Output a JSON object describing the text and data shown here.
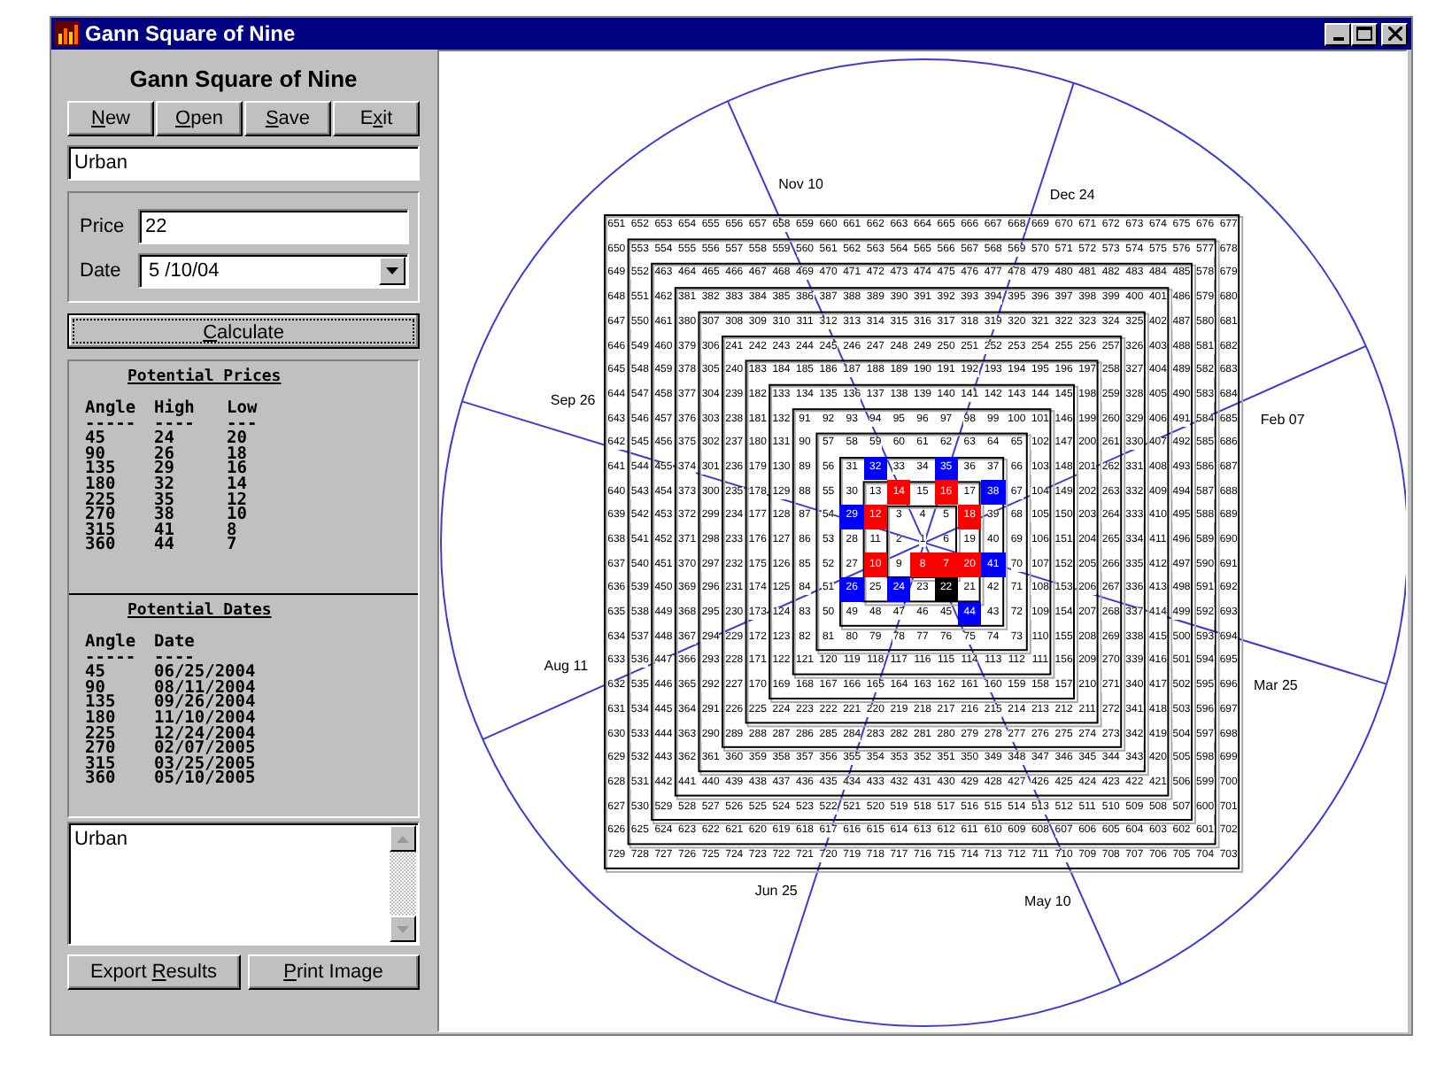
{
  "window": {
    "title": "Gann Square of Nine"
  },
  "sidebar": {
    "heading": "Gann Square of Nine",
    "file_buttons": [
      {
        "key": "N",
        "after": "ew"
      },
      {
        "key": "O",
        "after": "pen"
      },
      {
        "key": "S",
        "after": "ave"
      },
      {
        "before": "E",
        "key": "x",
        "after": "it"
      }
    ],
    "name_field": {
      "value": "Urban"
    },
    "price": {
      "label": "Price",
      "value": "22"
    },
    "date": {
      "label": "Date",
      "value": "5 /10/04"
    },
    "calculate_button": {
      "key": "C",
      "after": "alculate",
      "focused": true
    },
    "prices": {
      "heading": "Potential Prices",
      "columns": [
        "Angle",
        "High",
        "Low"
      ],
      "rules": [
        "-----",
        "----",
        "---"
      ],
      "rows": [
        [
          "45",
          "24",
          "20"
        ],
        [
          "90",
          "26",
          "18"
        ],
        [
          "135",
          "29",
          "16"
        ],
        [
          "180",
          "32",
          "14"
        ],
        [
          "225",
          "35",
          "12"
        ],
        [
          "270",
          "38",
          "10"
        ],
        [
          "315",
          "41",
          "8"
        ],
        [
          "360",
          "44",
          "7"
        ]
      ]
    },
    "dates": {
      "heading": "Potential Dates",
      "columns": [
        "Angle",
        "Date"
      ],
      "rules": [
        "-----",
        "----"
      ],
      "rows": [
        [
          "45",
          "06/25/2004"
        ],
        [
          "90",
          "08/11/2004"
        ],
        [
          "135",
          "09/26/2004"
        ],
        [
          "180",
          "11/10/2004"
        ],
        [
          "225",
          "12/24/2004"
        ],
        [
          "270",
          "02/07/2005"
        ],
        [
          "315",
          "03/25/2005"
        ],
        [
          "360",
          "05/10/2005"
        ]
      ]
    },
    "notes": {
      "value": "Urban"
    },
    "bottom_buttons": [
      {
        "before": "Export ",
        "key": "R",
        "after": "esults"
      },
      {
        "key": "P",
        "after": "rint Image"
      }
    ]
  },
  "square": {
    "dates": [
      "Nov 10",
      "Dec 24",
      "Feb 07",
      "Mar 25",
      "May 10",
      "Jun 25",
      "Aug 11",
      "Sep 26"
    ],
    "rows": [
      [
        "651",
        "652",
        "653",
        "654",
        "655",
        "656",
        "657",
        "658",
        "659",
        "660",
        "661",
        "662",
        "663",
        "664",
        "665",
        "666",
        "667",
        "668",
        "669",
        "670",
        "671",
        "672",
        "673",
        "674",
        "675",
        "676",
        "677"
      ],
      [
        "650",
        "553",
        "554",
        "555",
        "556",
        "557",
        "558",
        "559",
        "560",
        "561",
        "562",
        "563",
        "564",
        "565",
        "566",
        "567",
        "568",
        "569",
        "570",
        "571",
        "572",
        "573",
        "574",
        "575",
        "576",
        "577",
        "678"
      ],
      [
        "649",
        "552",
        "463",
        "464",
        "465",
        "466",
        "467",
        "468",
        "469",
        "470",
        "471",
        "472",
        "473",
        "474",
        "475",
        "476",
        "477",
        "478",
        "479",
        "480",
        "481",
        "482",
        "483",
        "484",
        "485",
        "578",
        "679"
      ],
      [
        "648",
        "551",
        "462",
        "381",
        "382",
        "383",
        "384",
        "385",
        "386",
        "387",
        "388",
        "389",
        "390",
        "391",
        "392",
        "393",
        "394",
        "395",
        "396",
        "397",
        "398",
        "399",
        "400",
        "401",
        "486",
        "579",
        "680"
      ],
      [
        "647",
        "550",
        "461",
        "380",
        "307",
        "308",
        "309",
        "310",
        "311",
        "312",
        "313",
        "314",
        "315",
        "316",
        "317",
        "318",
        "319",
        "320",
        "321",
        "322",
        "323",
        "324",
        "325",
        "402",
        "487",
        "580",
        "681"
      ],
      [
        "646",
        "549",
        "460",
        "379",
        "306",
        "241",
        "242",
        "243",
        "244",
        "245",
        "246",
        "247",
        "248",
        "249",
        "250",
        "251",
        "252",
        "253",
        "254",
        "255",
        "256",
        "257",
        "326",
        "403",
        "488",
        "581",
        "682"
      ],
      [
        "645",
        "548",
        "459",
        "378",
        "305",
        "240",
        "183",
        "184",
        "185",
        "186",
        "187",
        "188",
        "189",
        "190",
        "191",
        "192",
        "193",
        "194",
        "195",
        "196",
        "197",
        "258",
        "327",
        "404",
        "489",
        "582",
        "683"
      ],
      [
        "644",
        "547",
        "458",
        "377",
        "304",
        "239",
        "182",
        "133",
        "134",
        "135",
        "136",
        "137",
        "138",
        "139",
        "140",
        "141",
        "142",
        "143",
        "144",
        "145",
        "198",
        "259",
        "328",
        "405",
        "490",
        "583",
        "684"
      ],
      [
        "643",
        "546",
        "457",
        "376",
        "303",
        "238",
        "181",
        "132",
        "91",
        "92",
        "93",
        "94",
        "95",
        "96",
        "97",
        "98",
        "99",
        "100",
        "101",
        "146",
        "199",
        "260",
        "329",
        "406",
        "491",
        "584",
        "685"
      ],
      [
        "642",
        "545",
        "456",
        "375",
        "302",
        "237",
        "180",
        "131",
        "90",
        "57",
        "58",
        "59",
        "60",
        "61",
        "62",
        "63",
        "64",
        "65",
        "102",
        "147",
        "200",
        "261",
        "330",
        "407",
        "492",
        "585",
        "686"
      ],
      [
        "641",
        "544",
        "455",
        "374",
        "301",
        "236",
        "179",
        "130",
        "89",
        "56",
        "31",
        {
          "text": "32",
          "kind": "high"
        },
        "33",
        "34",
        {
          "text": "35",
          "kind": "high"
        },
        "36",
        "37",
        "66",
        "103",
        "148",
        "201",
        "262",
        "331",
        "408",
        "493",
        "586",
        "687"
      ],
      [
        "640",
        "543",
        "454",
        "373",
        "300",
        "235",
        "178",
        "129",
        "88",
        "55",
        "30",
        "13",
        {
          "text": "14",
          "kind": "low"
        },
        "15",
        {
          "text": "16",
          "kind": "low"
        },
        "17",
        {
          "text": "38",
          "kind": "high"
        },
        "67",
        "104",
        "149",
        "202",
        "263",
        "332",
        "409",
        "494",
        "587",
        "688"
      ],
      [
        "639",
        "542",
        "453",
        "372",
        "299",
        "234",
        "177",
        "128",
        "87",
        "54",
        {
          "text": "29",
          "kind": "high"
        },
        {
          "text": "12",
          "kind": "low"
        },
        "3",
        "4",
        "5",
        {
          "text": "18",
          "kind": "low"
        },
        "39",
        "68",
        "105",
        "150",
        "203",
        "264",
        "333",
        "410",
        "495",
        "588",
        "689"
      ],
      [
        "638",
        "541",
        "452",
        "371",
        "298",
        "233",
        "176",
        "127",
        "86",
        "53",
        "28",
        "11",
        "2",
        "1",
        "6",
        "19",
        "40",
        "69",
        "106",
        "151",
        "204",
        "265",
        "334",
        "411",
        "496",
        "589",
        "690"
      ],
      [
        "637",
        "540",
        "451",
        "370",
        "297",
        "232",
        "175",
        "126",
        "85",
        "52",
        "27",
        {
          "text": "10",
          "kind": "low"
        },
        "9",
        {
          "text": "8",
          "kind": "low"
        },
        {
          "text": "7",
          "kind": "low"
        },
        {
          "text": "20",
          "kind": "low"
        },
        {
          "text": "41",
          "kind": "high"
        },
        "70",
        "107",
        "152",
        "205",
        "266",
        "335",
        "412",
        "497",
        "590",
        "691"
      ],
      [
        "636",
        "539",
        "450",
        "369",
        "296",
        "231",
        "174",
        "125",
        "84",
        "51",
        {
          "text": "26",
          "kind": "high"
        },
        "25",
        {
          "text": "24",
          "kind": "high"
        },
        "23",
        {
          "text": "22",
          "kind": "price"
        },
        "21",
        "42",
        "71",
        "108",
        "153",
        "206",
        "267",
        "336",
        "413",
        "498",
        "591",
        "692"
      ],
      [
        "635",
        "538",
        "449",
        "368",
        "295",
        "230",
        "173",
        "124",
        "83",
        "50",
        "49",
        "48",
        "47",
        "46",
        "45",
        {
          "text": "44",
          "kind": "high"
        },
        "43",
        "72",
        "109",
        "154",
        "207",
        "268",
        "337",
        "414",
        "499",
        "592",
        "693"
      ],
      [
        "634",
        "537",
        "448",
        "367",
        "294",
        "229",
        "172",
        "123",
        "82",
        "81",
        "80",
        "79",
        "78",
        "77",
        "76",
        "75",
        "74",
        "73",
        "110",
        "155",
        "208",
        "269",
        "338",
        "415",
        "500",
        "593",
        "694"
      ],
      [
        "633",
        "536",
        "447",
        "366",
        "293",
        "228",
        "171",
        "122",
        "121",
        "120",
        "119",
        "118",
        "117",
        "116",
        "115",
        "114",
        "113",
        "112",
        "111",
        "156",
        "209",
        "270",
        "339",
        "416",
        "501",
        "594",
        "695"
      ],
      [
        "632",
        "535",
        "446",
        "365",
        "292",
        "227",
        "170",
        "169",
        "168",
        "167",
        "166",
        "165",
        "164",
        "163",
        "162",
        "161",
        "160",
        "159",
        "158",
        "157",
        "210",
        "271",
        "340",
        "417",
        "502",
        "595",
        "696"
      ],
      [
        "631",
        "534",
        "445",
        "364",
        "291",
        "226",
        "225",
        "224",
        "223",
        "222",
        "221",
        "220",
        "219",
        "218",
        "217",
        "216",
        "215",
        "214",
        "213",
        "212",
        "211",
        "272",
        "341",
        "418",
        "503",
        "596",
        "697"
      ],
      [
        "630",
        "533",
        "444",
        "363",
        "290",
        "289",
        "288",
        "287",
        "286",
        "285",
        "284",
        "283",
        "282",
        "281",
        "280",
        "279",
        "278",
        "277",
        "276",
        "275",
        "274",
        "273",
        "342",
        "419",
        "504",
        "597",
        "698"
      ],
      [
        "629",
        "532",
        "443",
        "362",
        "361",
        "360",
        "359",
        "358",
        "357",
        "356",
        "355",
        "354",
        "353",
        "352",
        "351",
        "350",
        "349",
        "348",
        "347",
        "346",
        "345",
        "344",
        "343",
        "420",
        "505",
        "598",
        "699"
      ],
      [
        "628",
        "531",
        "442",
        "441",
        "440",
        "439",
        "438",
        "437",
        "436",
        "435",
        "434",
        "433",
        "432",
        "431",
        "430",
        "429",
        "428",
        "427",
        "426",
        "425",
        "424",
        "423",
        "422",
        "421",
        "506",
        "599",
        "700"
      ],
      [
        "627",
        "530",
        "529",
        "528",
        "527",
        "526",
        "525",
        "524",
        "523",
        "522",
        "521",
        "520",
        "519",
        "518",
        "517",
        "516",
        "515",
        "514",
        "513",
        "512",
        "511",
        "510",
        "509",
        "508",
        "507",
        "600",
        "701"
      ],
      [
        "626",
        "625",
        "624",
        "623",
        "622",
        "621",
        "620",
        "619",
        "618",
        "617",
        "616",
        "615",
        "614",
        "613",
        "612",
        "611",
        "610",
        "609",
        "608",
        "607",
        "606",
        "605",
        "604",
        "603",
        "602",
        "601",
        "702"
      ],
      [
        "729",
        "728",
        "727",
        "726",
        "725",
        "724",
        "723",
        "722",
        "721",
        "720",
        "719",
        "718",
        "717",
        "716",
        "715",
        "714",
        "713",
        "712",
        "711",
        "710",
        "709",
        "708",
        "707",
        "706",
        "705",
        "704",
        "703"
      ]
    ]
  }
}
